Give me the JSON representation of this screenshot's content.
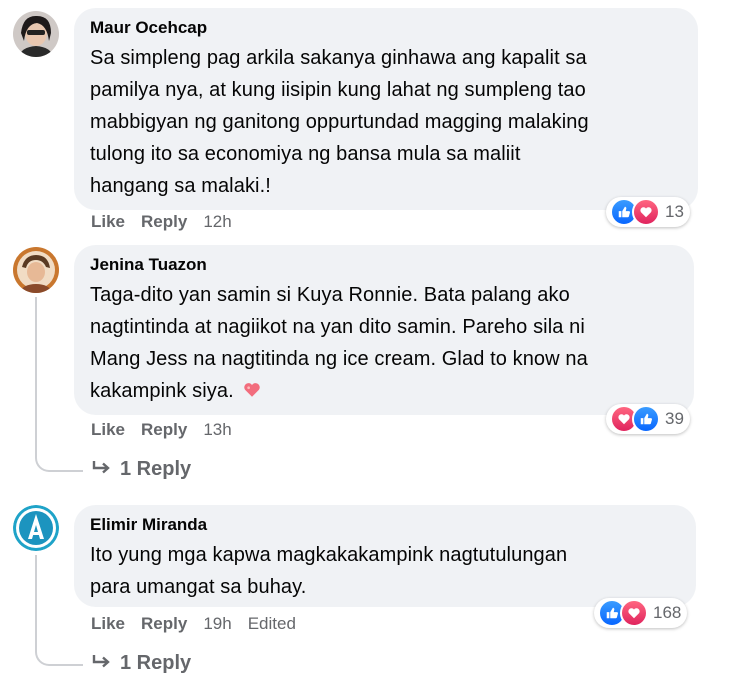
{
  "comments": [
    {
      "author": "Maur Ocehcap",
      "lines": [
        "Sa simpleng pag arkila sakanya ginhawa ang kapalit sa",
        "pamilya nya, at kung iisipin kung lahat ng sumpleng tao",
        "mabbigyan ng ganitong oppurtundad magging malaking",
        "tulong ito sa economiya ng bansa mula sa maliit",
        "hangang sa malaki.!"
      ],
      "like_label": "Like",
      "reply_label": "Reply",
      "time": "12h",
      "reaction_icons": [
        "like-icon",
        "love-icon"
      ],
      "reaction_count": "13"
    },
    {
      "author": "Jenina Tuazon",
      "lines": [
        "Taga-dito yan samin si Kuya Ronnie. Bata palang ako",
        "nagtintinda at nagiikot na yan dito samin. Pareho sila ni",
        "Mang Jess na nagtitinda ng ice cream. Glad to know na",
        "kakampink siya."
      ],
      "like_label": "Like",
      "reply_label": "Reply",
      "time": "13h",
      "reaction_icons": [
        "love-icon",
        "like-icon"
      ],
      "reaction_count": "39",
      "view_replies": "1 Reply"
    },
    {
      "author": "Elimir Miranda",
      "lines": [
        "Ito yung mga kapwa magkakakampink nagtutulungan",
        "para umangat sa buhay."
      ],
      "like_label": "Like",
      "reply_label": "Reply",
      "time": "19h",
      "edited": "Edited",
      "reaction_icons": [
        "like-icon",
        "love-icon"
      ],
      "reaction_count": "168",
      "view_replies": "1 Reply"
    }
  ],
  "colors": {
    "like": "#0866ff",
    "love": "#e0245e",
    "bubble": "#f0f2f5",
    "muted": "#65676b"
  }
}
